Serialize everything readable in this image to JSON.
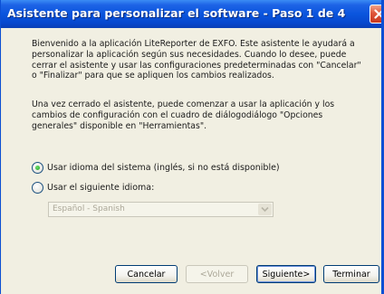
{
  "window": {
    "title": "Asistente para personalizar el software - Paso 1 de 4",
    "close_icon": "close-icon"
  },
  "intro": {
    "paragraph1": "Bienvenido a la aplicación LiteReporter de EXFO. Este asistente le ayudará a personalizar la aplicación según sus necesidades. Cuando lo desee, puede cerrar el asistente y usar las configuraciones predeterminadas con \"Cancelar\" o \"Finalizar\" para que se apliquen los cambios realizados.",
    "paragraph2": "Una vez cerrado el asistente, puede comenzar a usar la aplicación y los cambios de configuración con el cuadro de diálogodiálogo \"Opciones generales\" disponible en \"Herramientas\"."
  },
  "language": {
    "option_system_label": "Usar idioma del sistema (inglés, si no está disponible)",
    "option_system_selected": true,
    "option_custom_label": "Usar el siguiente idioma:",
    "option_custom_selected": false,
    "select_value": "Español - Spanish",
    "select_enabled": false
  },
  "buttons": {
    "cancel": "Cancelar",
    "back": "<Volver",
    "next": "Siguiente>",
    "finish": "Terminar"
  },
  "colors": {
    "titlebar": "#0a55dd",
    "close": "#e0563a",
    "dialog_bg": "#f1efe2",
    "radio_selected": "#21a121"
  }
}
